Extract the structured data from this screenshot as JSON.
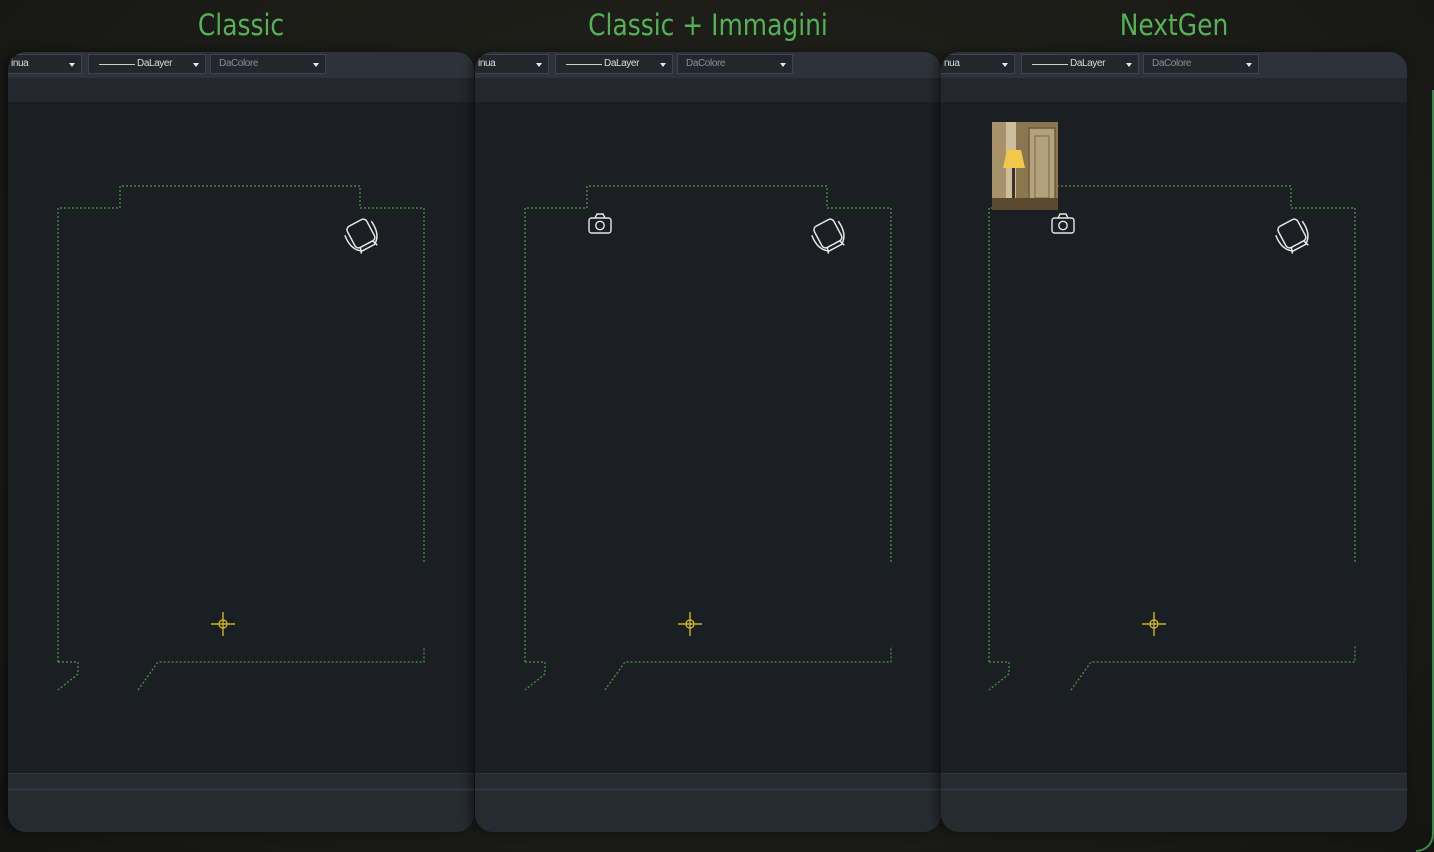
{
  "panels": [
    {
      "title": "Classic",
      "toolbar": {
        "linetype": "inua",
        "layer": "DaLayer",
        "color": "DaColore"
      },
      "show_camera": false,
      "show_thumbnail": false,
      "icons": [
        "armchair-icon",
        "crosshair-icon"
      ]
    },
    {
      "title": "Classic + Immagini",
      "toolbar": {
        "linetype": "inua",
        "layer": "DaLayer",
        "color": "DaColore"
      },
      "show_camera": true,
      "show_thumbnail": false,
      "icons": [
        "camera-icon",
        "armchair-icon",
        "crosshair-icon"
      ]
    },
    {
      "title": "NextGen",
      "toolbar": {
        "linetype": "nua",
        "layer": "DaLayer",
        "color": "DaColore"
      },
      "show_camera": true,
      "show_thumbnail": true,
      "icons": [
        "photo-thumbnail",
        "camera-icon",
        "armchair-icon",
        "crosshair-icon"
      ]
    }
  ],
  "colors": {
    "caption": "#55b254",
    "outline": "#4a9a45",
    "crosshair": "#c8b420",
    "icon": "#e6e6e6",
    "panel": "#1b1e23"
  }
}
